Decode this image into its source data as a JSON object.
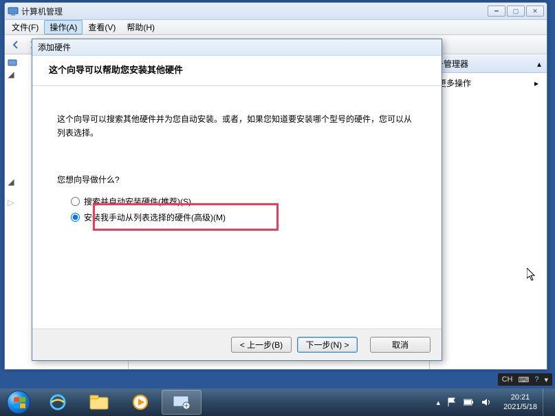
{
  "mainWindow": {
    "title": "计算机管理",
    "menus": {
      "file": "文件(F)",
      "action": "操作(A)",
      "view": "查看(V)",
      "help": "帮助(H)"
    }
  },
  "actionsPane": {
    "header": "备管理器",
    "more": "更多操作"
  },
  "dialog": {
    "title": "添加硬件",
    "heading": "这个向导可以帮助您安装其他硬件",
    "desc1": "这个向导可以搜索其他硬件并为您自动安装。或者，如果您知道要安装哪个型号的硬件，您可以从列表选择。",
    "question": "您想向导做什么?",
    "radio1": "搜索并自动安装硬件(推荐)(S)",
    "radio2": "安装我手动从列表选择的硬件(高级)(M)",
    "back": "< 上一步(B)",
    "next": "下一步(N) >",
    "cancel": "取消"
  },
  "langBar": {
    "ch": "CH"
  },
  "clock": {
    "time": "20:21",
    "date": "2021/5/18"
  }
}
